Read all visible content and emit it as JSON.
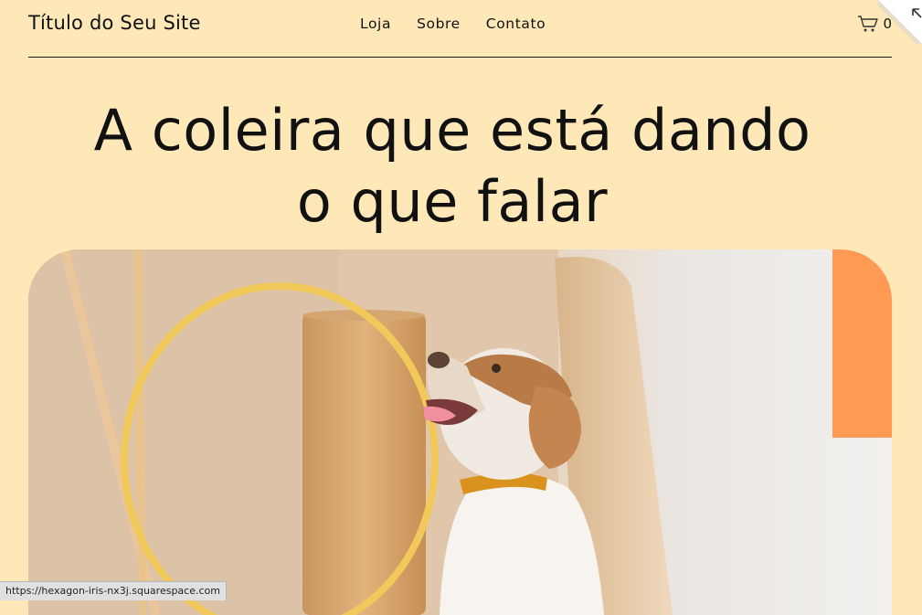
{
  "header": {
    "site_title": "Título do Seu Site",
    "nav": [
      "Loja",
      "Sobre",
      "Contato"
    ],
    "cart_count": "0"
  },
  "hero": {
    "title_line1": "A coleira que está dando",
    "title_line2": "o que falar",
    "image_alt": "dog-with-collar-photo"
  },
  "status_bar": {
    "url": "https://hexagon-iris-nx3j.squarespace.com"
  },
  "colors": {
    "background": "#ffe8b8",
    "text": "#111111",
    "accent_orange": "#ff9a55",
    "collar": "#d8921d"
  },
  "icons": [
    "cart-icon",
    "collapse-arrow-icon"
  ]
}
